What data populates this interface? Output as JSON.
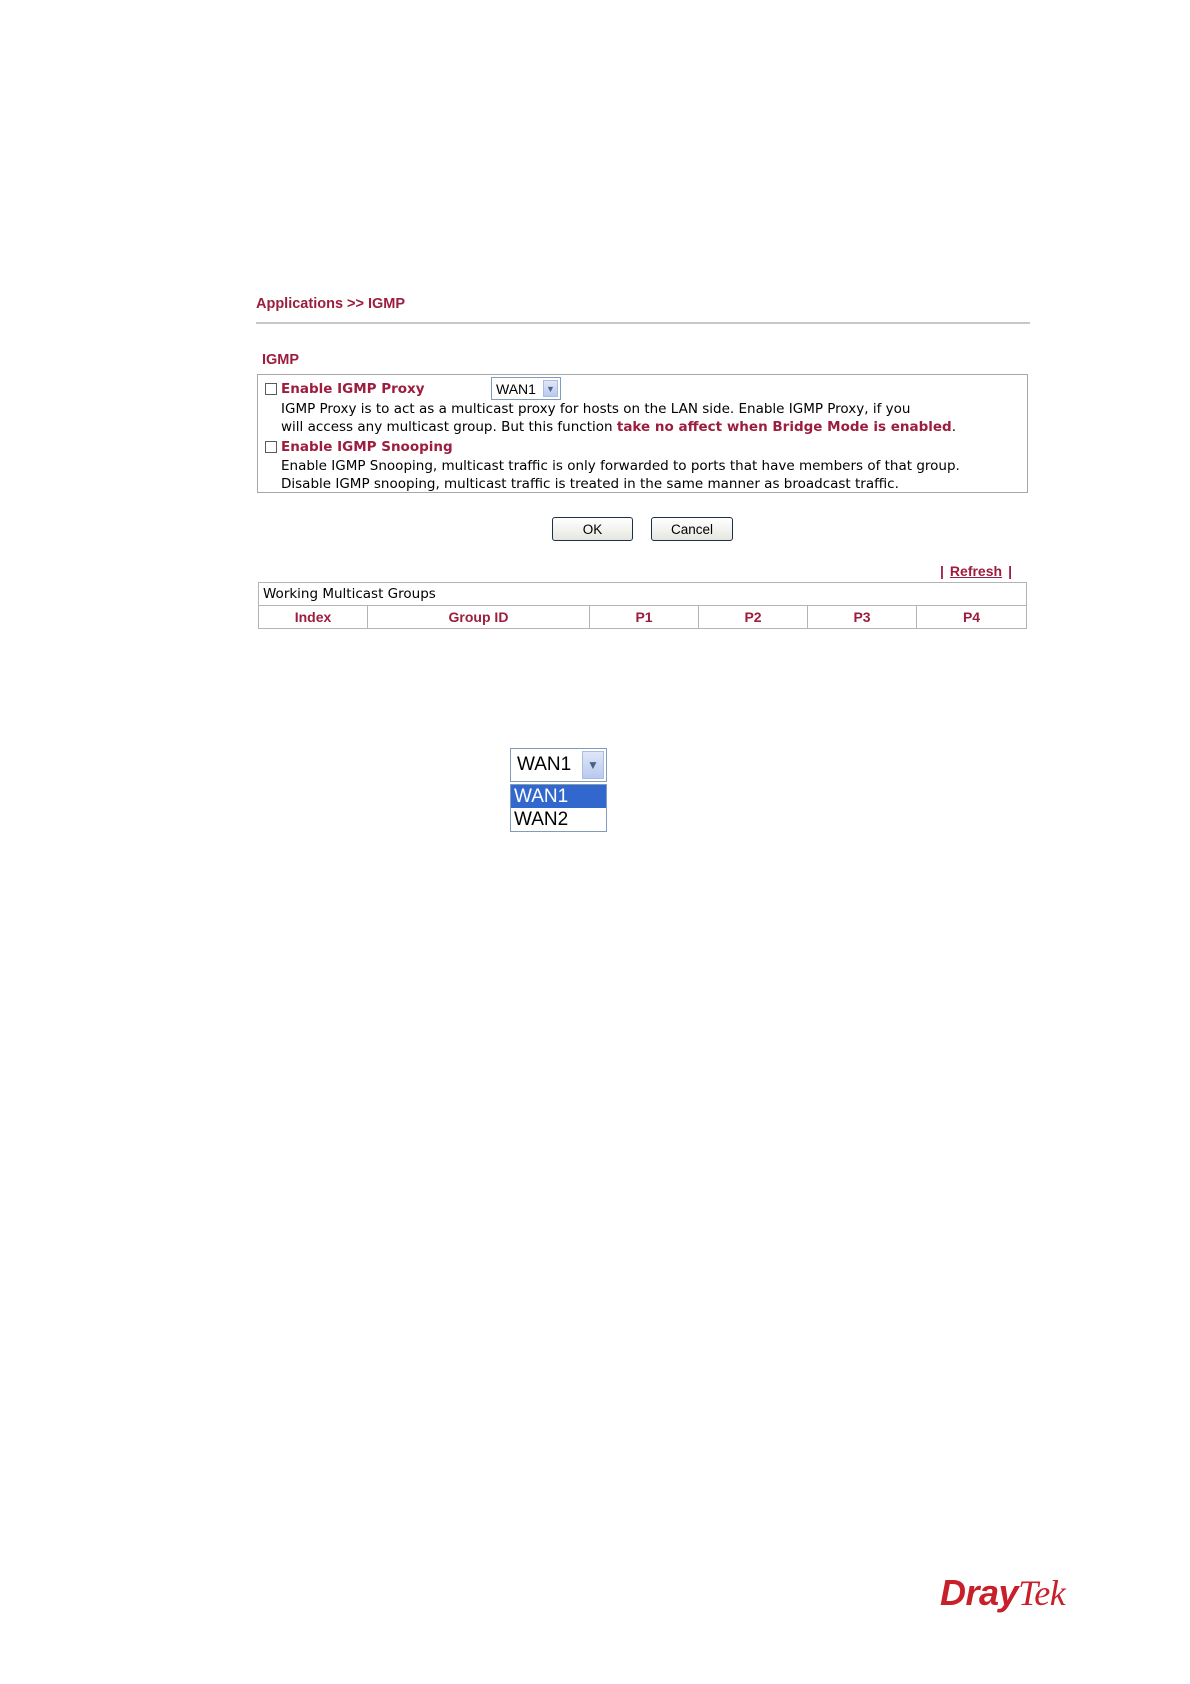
{
  "breadcrumb": "Applications >> IGMP",
  "section_title": "IGMP",
  "proxy": {
    "checked": false,
    "label": "Enable IGMP Proxy",
    "wan_select_value": "WAN1",
    "desc_line1": "IGMP Proxy is to act as a multicast proxy for hosts on the LAN side. Enable IGMP Proxy, if you",
    "desc_line2_prefix": "will access any multicast group. But this function ",
    "desc_line2_warning": "take no affect when Bridge Mode is enabled",
    "desc_line2_suffix": "."
  },
  "snooping": {
    "checked": false,
    "label": "Enable IGMP Snooping",
    "desc_line1": "Enable IGMP Snooping, multicast traffic is only forwarded to ports that have members of that group.",
    "desc_line2": "Disable IGMP snooping, multicast traffic is treated in the same manner as broadcast traffic."
  },
  "buttons": {
    "ok": "OK",
    "cancel": "Cancel"
  },
  "refresh": {
    "separator": "|",
    "label": "Refresh"
  },
  "groups_table": {
    "caption": "Working Multicast Groups",
    "columns": [
      "Index",
      "Group ID",
      "P1",
      "P2",
      "P3",
      "P4"
    ]
  },
  "dropdown_example": {
    "value": "WAN1",
    "options": [
      "WAN1",
      "WAN2"
    ],
    "highlighted": "WAN1"
  },
  "logo": {
    "part1": "Dray",
    "part2": "Tek"
  },
  "colors": {
    "accent": "#9c1d3d",
    "highlight": "#3267cd",
    "logo": "#c8202a"
  }
}
